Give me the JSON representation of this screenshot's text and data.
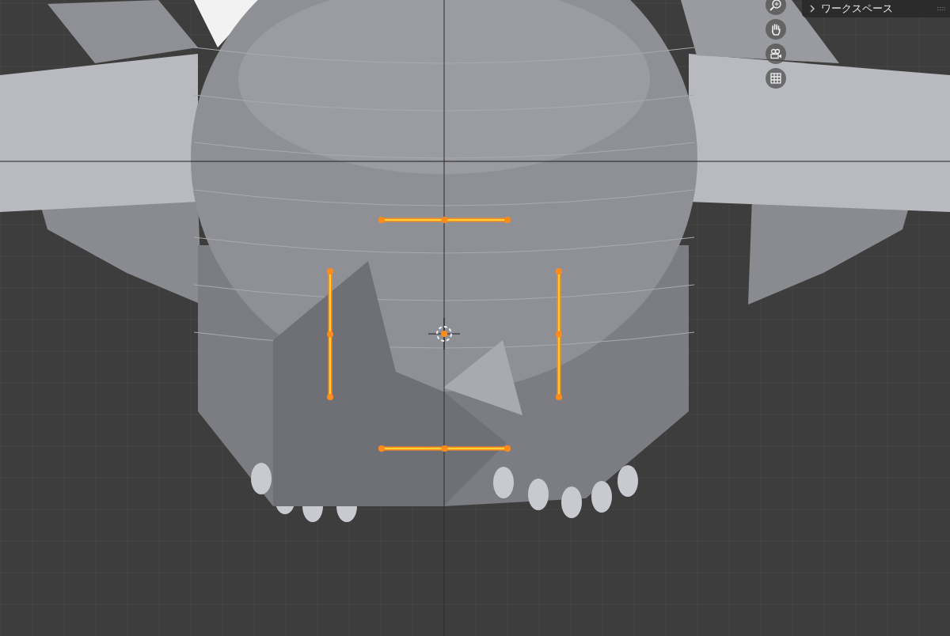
{
  "panel": {
    "title": "ワークスペース",
    "expanded": false
  }
}
